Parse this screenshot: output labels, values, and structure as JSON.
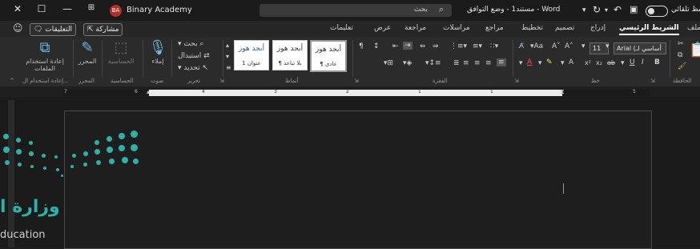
{
  "titlebar": {
    "user_initials": "BA",
    "user_name": "Binary Academy",
    "search_label": "بحث",
    "doc_title": "مستند1 - وضع التوافق - Word",
    "autosave_label": "حفظ تلقائي"
  },
  "tabs": {
    "file": "ملف",
    "home": "الشريط الرئيسي",
    "insert": "إدراج",
    "design": "تصميم",
    "layout": "تخطيط",
    "references": "مراجع",
    "mailings": "مراسلات",
    "review": "مراجعة",
    "view": "عرض",
    "help": "تعليمات",
    "share": "مشاركة",
    "comments": "التعليقات"
  },
  "ribbon": {
    "font_name": "Arial (أساسي لـ",
    "font_size": "11",
    "find": "بحث",
    "replace": "استبدال",
    "select": "تحديد",
    "dictate": "إملاء",
    "editor": "المحرر",
    "sensitivity": "الحساسية",
    "reuse_files": "إعادة استخدام الملفات",
    "styles": [
      {
        "sample": "أبجد هوز",
        "name": "¶ عادي"
      },
      {
        "sample": "أبجد هوز",
        "name": "¶ بلا تباعد"
      },
      {
        "sample": "أبجد هوز",
        "name": "عنوان 1"
      }
    ]
  },
  "groups": {
    "clipboard": "الحافظة",
    "font": "خط",
    "paragraph": "الفقرة",
    "styles": "أنماط",
    "editing": "تحرير",
    "voice": "صوت",
    "sensitivity": "الحساسية",
    "editor": "المحرر",
    "reuse": "إعادة استخدام ال..."
  },
  "ruler_numbers": [
    "1",
    "1",
    "2",
    "3",
    "4",
    "5",
    "6",
    "7"
  ],
  "logo": {
    "arabic": "وزارة ا",
    "english": "ducation"
  },
  "colors": {
    "accent_teal": "#2bb3a8",
    "avatar_red": "#b0302a"
  }
}
